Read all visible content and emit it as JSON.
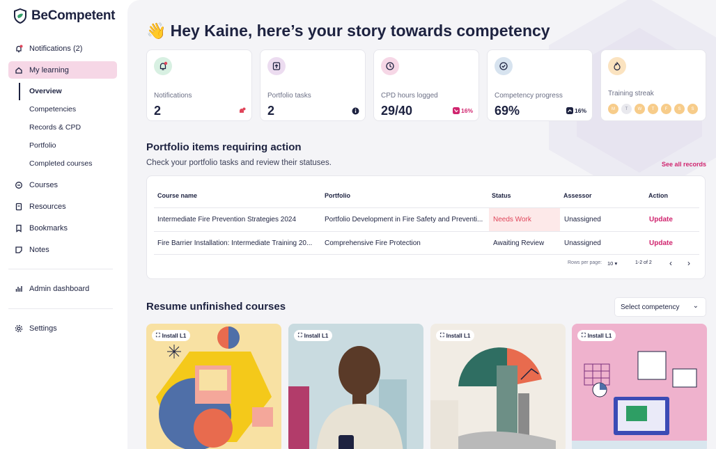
{
  "app": {
    "name": "BeCompetent"
  },
  "sidebar": {
    "items": [
      {
        "label": "Notifications (2)"
      },
      {
        "label": "My learning"
      },
      {
        "label": "Courses"
      },
      {
        "label": "Resources"
      },
      {
        "label": "Bookmarks"
      },
      {
        "label": "Notes"
      },
      {
        "label": "Admin dashboard"
      },
      {
        "label": "Settings"
      }
    ],
    "sub_items": [
      {
        "label": "Overview"
      },
      {
        "label": "Competencies"
      },
      {
        "label": "Records & CPD"
      },
      {
        "label": "Portfolio"
      },
      {
        "label": "Completed courses"
      }
    ]
  },
  "header": {
    "emoji": "👋",
    "greeting": "Hey Kaine, here’s your story towards competency"
  },
  "cards": [
    {
      "label": "Notifications",
      "value": "2",
      "icon": "bell-icon"
    },
    {
      "label": "Portfolio tasks",
      "value": "2",
      "icon": "upload-icon"
    },
    {
      "label": "CPD hours logged",
      "value": "29/40",
      "badge": "16%",
      "icon": "clock-icon"
    },
    {
      "label": "Competency progress",
      "value": "69%",
      "badge": "16%",
      "icon": "check-circle-icon"
    },
    {
      "label": "Training streak",
      "icon": "flame-icon",
      "days": [
        "M",
        "T",
        "W",
        "T",
        "F",
        "S",
        "S"
      ]
    }
  ],
  "portfolio": {
    "title": "Portfolio items requiring action",
    "subtitle": "Check your portfolio tasks and review their statuses.",
    "see_all": "See all records",
    "columns": [
      "Course name",
      "Portfolio",
      "Status",
      "Assessor",
      "Action"
    ],
    "rows": [
      {
        "course": "Intermediate Fire Prevention Strategies 2024",
        "portfolio": "Portfolio Development in Fire Safety and Preventi...",
        "status": "Needs Work",
        "assessor": "Unassigned",
        "action": "Update"
      },
      {
        "course": "Fire Barrier Installation: Intermediate Training 20...",
        "portfolio": "Comprehensive Fire Protection",
        "status": "Awaiting Review",
        "assessor": "Unassigned",
        "action": "Update"
      }
    ],
    "pager": {
      "rows_label": "Rows per page:",
      "rows_value": "10",
      "range": "1-2 of 2"
    }
  },
  "resume": {
    "title": "Resume unfinished courses",
    "select_placeholder": "Select competency",
    "courses": [
      {
        "chip": "Install L1"
      },
      {
        "chip": "Install L1"
      },
      {
        "chip": "Install L1"
      },
      {
        "chip": "Install L1"
      }
    ]
  },
  "colors": {
    "accent": "#d0246e",
    "nav_active": "#f6d7e6",
    "navy": "#1d2240"
  }
}
